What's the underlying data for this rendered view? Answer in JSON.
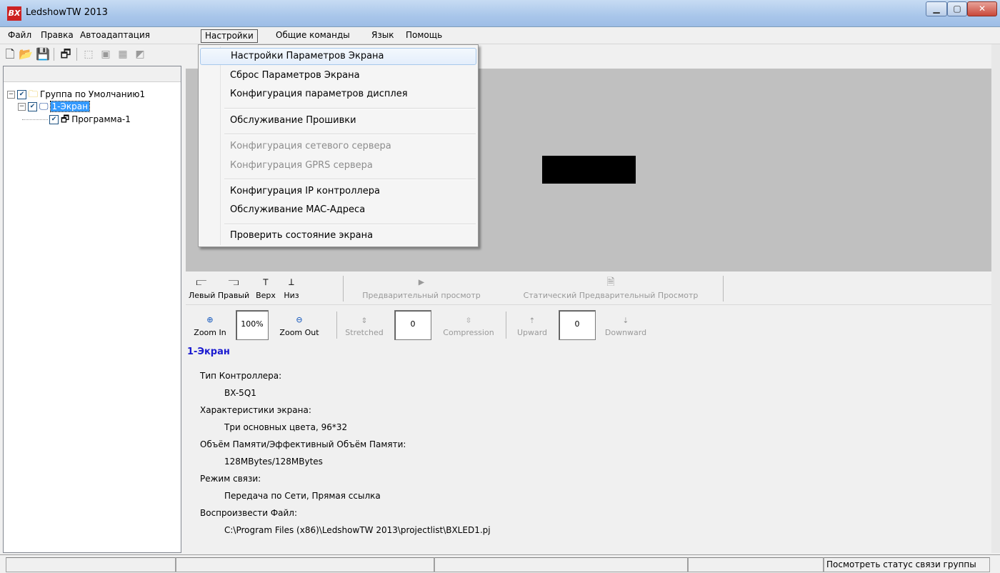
{
  "window": {
    "title": "LedshowTW 2013",
    "logo_text": "BX",
    "min_glyph": "▁",
    "max_glyph": "▢",
    "close_glyph": "✕"
  },
  "menubar": {
    "items": [
      "Файл",
      "Правка",
      "Автоадаптация",
      "Настройки",
      "Общие команды",
      "Язык",
      "Помощь"
    ]
  },
  "settings_menu": {
    "items": [
      {
        "label": "Настройки Параметров Экрана",
        "enabled": true,
        "highlighted": true
      },
      {
        "label": "Сброс Параметров Экрана",
        "enabled": true
      },
      {
        "label": "Конфигурация параметров дисплея",
        "enabled": true
      },
      {
        "label": "Обслуживание Прошивки",
        "enabled": true
      },
      {
        "label": "Конфигурация сетевого сервера",
        "enabled": false
      },
      {
        "label": "Конфигурация GPRS сервера",
        "enabled": false
      },
      {
        "label": "Конфигурация IP контроллера",
        "enabled": true
      },
      {
        "label": "Обслуживание MAC-Адреса",
        "enabled": true
      },
      {
        "label": "Проверить состояние экрана",
        "enabled": true
      }
    ]
  },
  "tree": {
    "group": {
      "label": "Группа по Умолчанию1",
      "expander": "−",
      "checked": "✔"
    },
    "screen": {
      "label": "1-Экран",
      "expander": "−",
      "checked": "✔"
    },
    "program": {
      "label": "Программа-1",
      "checked": "✔"
    }
  },
  "align_toolbar": {
    "left": "Левый",
    "right": "Правый",
    "top": "Верх",
    "bottom": "Низ",
    "preview": "Предварительный просмотр",
    "static_preview": "Статический Предварительный Просмотр"
  },
  "zoom_toolbar": {
    "zoom_in": "Zoom In",
    "zoom_value": "100%",
    "zoom_out": "Zoom Out",
    "stretched": "Stretched",
    "stretched_value": "0",
    "compression": "Compression",
    "upward": "Upward",
    "upward_value": "0",
    "downward": "Downward"
  },
  "info": {
    "title": "1-Экран",
    "controller_type_label": "Тип Контроллера:",
    "controller_type_value": "BX-5Q1",
    "screen_props_label": "Характеристики экрана:",
    "screen_props_value": "Три основных цвета, 96*32",
    "memory_label": "Объём Памяти/Эффективный Объём Памяти:",
    "memory_value": "128MBytes/128MBytes",
    "comm_mode_label": "Режим связи:",
    "comm_mode_value": "Передача по Сети, Прямая ссылка",
    "play_file_label": "Воспроизвести Файл:",
    "play_file_value": "C:\\Program Files (x86)\\LedshowTW 2013\\projectlist\\BXLED1.pj"
  },
  "statusbar": {
    "group_link_status": "Посмотреть статус связи группы"
  }
}
